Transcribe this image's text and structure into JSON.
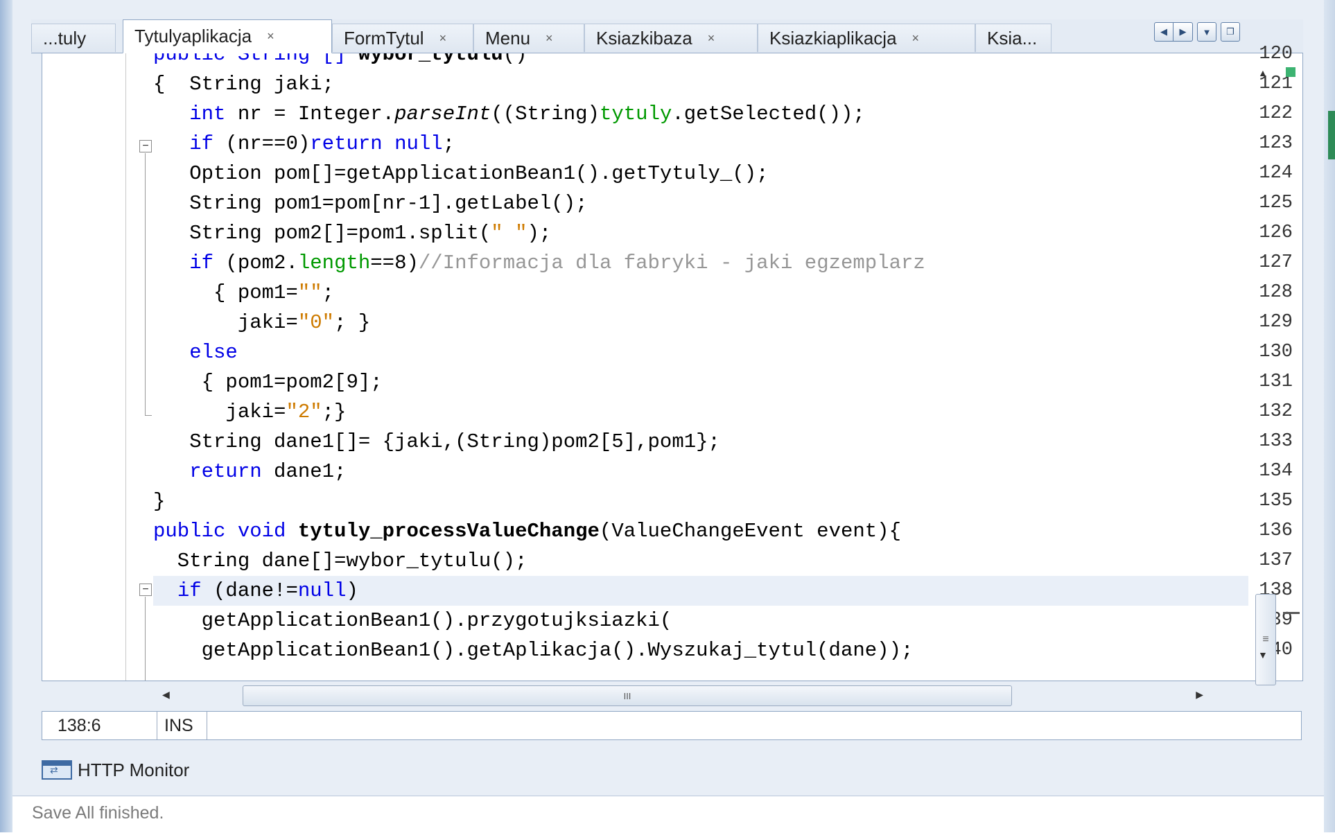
{
  "tabs": [
    {
      "label": "...tuly",
      "closable": false,
      "active": false
    },
    {
      "label": "Tytulyaplikacja",
      "closable": true,
      "active": true
    },
    {
      "label": "FormTytul",
      "closable": true,
      "active": false
    },
    {
      "label": "Menu",
      "closable": true,
      "active": false
    },
    {
      "label": "Ksiazkibaza",
      "closable": true,
      "active": false
    },
    {
      "label": "Ksiazkiaplikacja",
      "closable": true,
      "active": false
    },
    {
      "label": "Ksia...",
      "closable": false,
      "active": false
    }
  ],
  "tab_close_glyph": "×",
  "tab_nav": {
    "prev": "◀",
    "next": "▶",
    "dropdown": "▼",
    "restore": "❐"
  },
  "editor": {
    "line_numbers": [
      "120",
      "121",
      "122",
      "123",
      "124",
      "125",
      "126",
      "127",
      "128",
      "129",
      "130",
      "131",
      "132",
      "133",
      "134",
      "135",
      "136",
      "137",
      "138",
      "139",
      "140"
    ],
    "current_line_index": 18,
    "code_lines": [
      [
        {
          "t": "public String [] ",
          "c": "kw-mix"
        }
      ],
      [],
      [],
      [],
      [],
      [],
      [],
      [],
      [],
      [],
      [],
      [],
      [],
      [],
      [],
      [],
      [],
      [],
      [],
      [],
      []
    ],
    "code_text": [
      "public String [] wybor_tytulu()",
      "{  String jaki;",
      "   int nr = Integer.parseInt((String)tytuly.getSelected());",
      "   if (nr==0)return null;",
      "   Option pom[]=getApplicationBean1().getTytuly_();",
      "   String pom1=pom[nr-1].getLabel();",
      "   String pom2[]=pom1.split(\" \");",
      "   if (pom2.length==8)//Informacja dla fabryki - jaki egzemplarz",
      "     { pom1=\"\";",
      "       jaki=\"0\"; }",
      "   else",
      "    { pom1=pom2[9];",
      "      jaki=\"2\";}",
      "   String dane1[]= {jaki,(String)pom2[5],pom1};",
      "   return dane1;",
      "}",
      "public void tytuly_processValueChange(ValueChangeEvent event){",
      "  String dane[]=wybor_tytulu();",
      "  if (dane!=null)",
      "    getApplicationBean1().przygotujksiazki(",
      "    getApplicationBean1().getAplikacja().Wyszukaj_tytul(dane));"
    ]
  },
  "scrollbar": {
    "h_thumb_grip": "III",
    "v_thumb_grip": "≡"
  },
  "editor_status": {
    "position": "138:6",
    "mode": "INS"
  },
  "bottom_panel": {
    "http_monitor_label": "HTTP Monitor"
  },
  "status_bar": {
    "message": "Save All finished."
  }
}
